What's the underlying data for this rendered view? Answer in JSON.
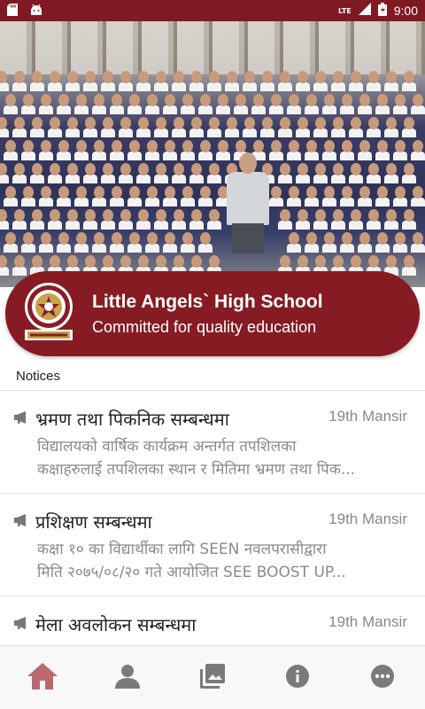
{
  "status_bar": {
    "time": "9:00",
    "network": "LTE",
    "icons": [
      "sd-card-icon",
      "android-icon",
      "signal-icon",
      "battery-icon"
    ]
  },
  "school": {
    "name": "Little Angels` High School",
    "tagline": "Committed for quality education"
  },
  "notices": {
    "title": "Notices",
    "items": [
      {
        "title": "भ्रमण तथा पिकनिक सम्बन्धमा",
        "date": "19th Mansir",
        "line1": "विद्यालयको वार्षिक कार्यक्रम अन्तर्गत तपशिलका",
        "line2": "कक्षाहरुलाई तपशिलका स्थान र मितिमा भ्रमण तथा पिक..."
      },
      {
        "title": "प्रशिक्षण सम्बन्धमा",
        "date": "19th Mansir",
        "line1": "कक्षा १० का विद्यार्थीका लागि SEEN नवलपरासीद्वारा",
        "line2": "मिति २०७५/०८/२० गते आयोजित SEE BOOST UP..."
      },
      {
        "title": "मेला अवलोकन सम्बन्धमा",
        "date": "19th Mansir",
        "line1": "",
        "line2": ""
      }
    ]
  },
  "bottom_nav": {
    "items": [
      "home-icon",
      "person-icon",
      "gallery-icon",
      "info-icon",
      "more-icon"
    ],
    "active_color": "#b86a6e",
    "inactive_color": "#7a7a7a"
  },
  "colors": {
    "brand": "#861b23",
    "status_bar": "#7f1a22"
  }
}
